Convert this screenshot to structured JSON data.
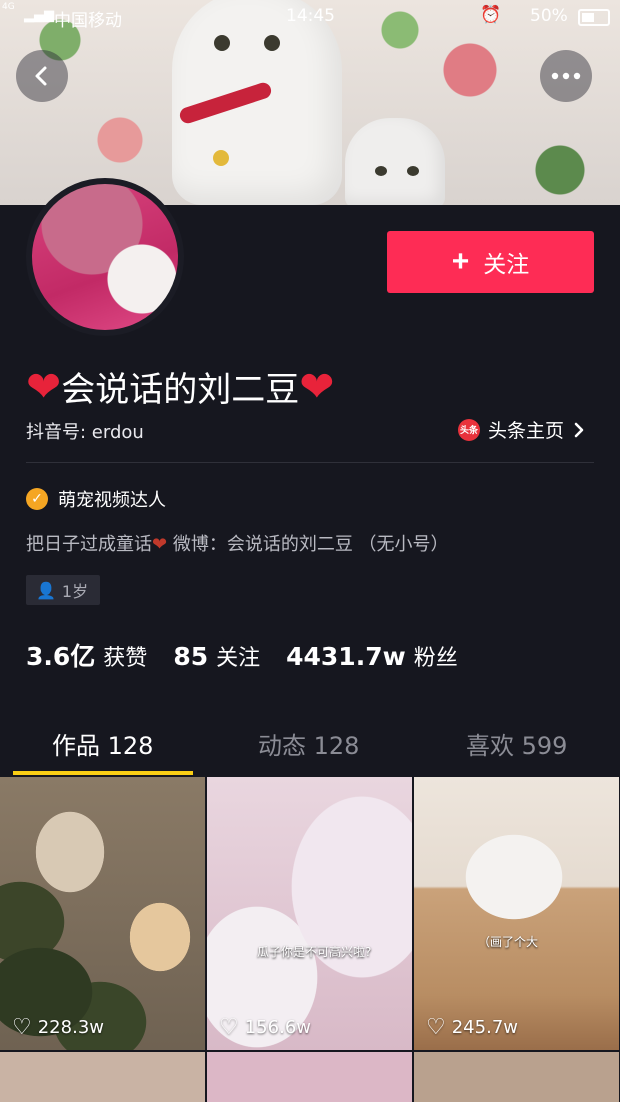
{
  "status_bar": {
    "carrier": "中国移动",
    "network": "4G",
    "time": "14:45",
    "battery": "50%"
  },
  "profile": {
    "follow_label": "关注",
    "nickname": "会说话的刘二豆",
    "douyin_id": "抖音号: erdou",
    "toutiao_label": "头条主页",
    "toutiao_logo": "头条",
    "verification": "萌宠视频达人",
    "bio": "把日子过成童话",
    "bio_weibo": "微博：会说话的刘二豆 （无小号）",
    "age_tag": "1岁"
  },
  "stats": [
    {
      "value": "3.6亿",
      "label": "获赞"
    },
    {
      "value": "85",
      "label": "关注"
    },
    {
      "value": "4431.7w",
      "label": "粉丝"
    }
  ],
  "tabs": {
    "works": "作品 128",
    "dynamic": "动态 128",
    "likes": "喜欢 599"
  },
  "videos": [
    {
      "likes": "228.3w",
      "caption": ""
    },
    {
      "likes": "156.6w",
      "caption": "瓜子你是不可高兴啦?"
    },
    {
      "likes": "245.7w",
      "caption": "（画了个大"
    }
  ],
  "colors": {
    "accent": "#fe2c55",
    "tab_indicator": "#face15",
    "background": "#16171f"
  }
}
